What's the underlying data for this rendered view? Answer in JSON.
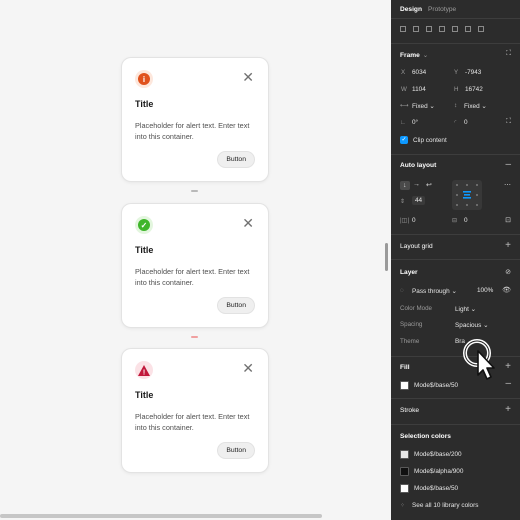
{
  "cards": [
    {
      "icon": "info-icon",
      "icon_color": "#e0521d",
      "icon_bg": "#fde7dc",
      "icon_glyph": "i",
      "title": "Title",
      "body": "Placeholder for alert text. Enter text into this container.",
      "button": "Button"
    },
    {
      "icon": "check-icon",
      "icon_color": "#3fb52a",
      "icon_bg": "#e3f6de",
      "icon_glyph": "✓",
      "title": "Title",
      "body": "Placeholder for alert text. Enter text into this container.",
      "button": "Button"
    },
    {
      "icon": "warning-icon",
      "icon_color": "#c1183b",
      "icon_bg": "#fbe2e6",
      "icon_glyph": "!",
      "title": "Title",
      "body": "Placeholder for alert text. Enter text into this container.",
      "button": "Button"
    }
  ],
  "panel": {
    "tabs": [
      "Design",
      "Prototype"
    ],
    "frame": {
      "title": "Frame",
      "x_label": "X",
      "x": "6034",
      "y_label": "Y",
      "y": "-7943",
      "w_label": "W",
      "w": "1104",
      "h_label": "H",
      "h": "16742",
      "w_mode": "Fixed",
      "h_mode": "Fixed",
      "rotation": "0°",
      "radius": "0",
      "clip_content": "Clip content"
    },
    "auto_layout": {
      "title": "Auto layout",
      "spacing": "44",
      "padding_h": "0",
      "padding_v": "0"
    },
    "layout_grid": {
      "title": "Layout grid"
    },
    "layer": {
      "title": "Layer",
      "blend": "Pass through",
      "opacity": "100%",
      "props": [
        {
          "label": "Color Mode",
          "value": "Light"
        },
        {
          "label": "Spacing",
          "value": "Spacious"
        },
        {
          "label": "Theme",
          "value": "Bra"
        }
      ]
    },
    "fill": {
      "title": "Fill",
      "value": "Mode$/base/50",
      "swatch": "#ffffff"
    },
    "stroke": {
      "title": "Stroke"
    },
    "selection_colors": {
      "title": "Selection colors",
      "items": [
        {
          "name": "Mode$/base/200",
          "swatch": "#e8e8e8"
        },
        {
          "name": "Mode$/alpha/900",
          "swatch": "#111111"
        },
        {
          "name": "Mode$/base/50",
          "swatch": "#ffffff"
        }
      ],
      "see_all": "See all 10 library colors"
    }
  },
  "colors": {
    "canvas": "#f5f5f5",
    "panel": "#2c2c2c",
    "accent": "#0d99ff",
    "gap_marker_1": "#b9b9b9",
    "gap_marker_2": "#f0a0a0"
  }
}
